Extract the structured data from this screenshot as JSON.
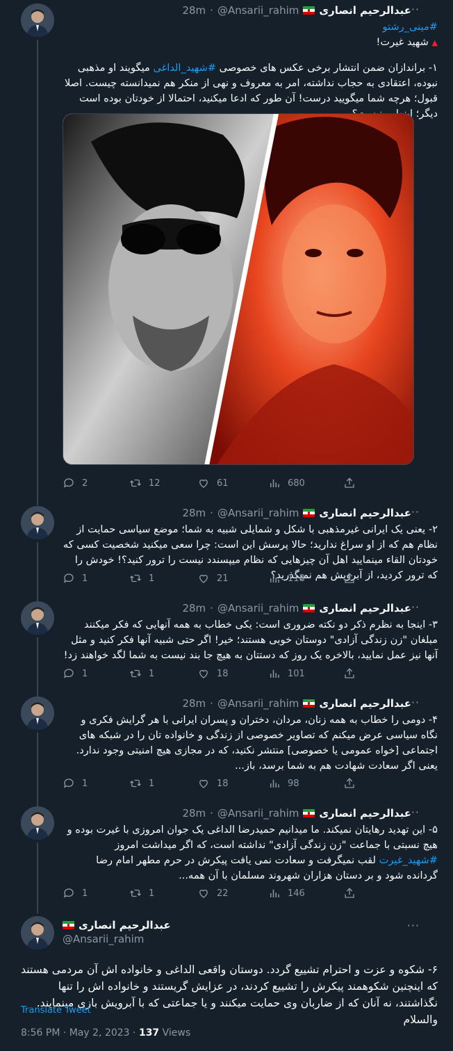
{
  "author": {
    "name": "عبدالرحیم انصاری",
    "handle": "@Ansarii_rahim",
    "flag": "iran-flag-icon"
  },
  "tweets": [
    {
      "time": "28m",
      "hashtag_top": "#مینی_رشتو",
      "subtitle": "شهید غیرت!",
      "text_pre": "۱- براندازان ضمن انتشار برخی عکس های خصوصی ",
      "text_tag": "#شهید_الداغی",
      "text_post": " میگویند او مذهبی نبوده، اعتقادی به حجاب نداشته، امر به معروف و نهی از منکر هم نمیدانسته چیست. اصلا قبول؛ هرچه شما میگویید درست! آن طور که ادعا میکنید، احتمالا از خودتان بوده است دیگر؛ اینطور نیست؟",
      "replies": "2",
      "retweets": "12",
      "likes": "61",
      "views": "680"
    },
    {
      "time": "28m",
      "text": "۲- یعنی یک ایرانی غیرمذهبی با شکل و شمایلی شبیه به شما؛ موضع سیاسی حمایت از نظام هم که از او سراغ ندارید؛ حالا پرسش این است: چرا سعی میکنید شخصیت کسی که خودتان القاء مینمایید اهل آن چیزهایی که نظام میپسندد نیست را ترور کنید؟! خودش را که ترور کردید، از آبرویش هم نمیگذرید؟",
      "replies": "1",
      "retweets": "1",
      "likes": "21",
      "views": "118"
    },
    {
      "time": "28m",
      "text": "۳- اینجا به نظرم ذکر دو نکته ضروری است: یکی خطاب به همه آنهایی که فکر میکنند مبلغان \"زن زندگی آزادی\" دوستان خوبی هستند؛ خیر! اگر حتی شبیه آنها فکر کنید و مثل آنها نیز عمل نمایید، بالاخره یک روز که دستتان به هیچ جا بند نیست به شما لگد خواهند زد!",
      "replies": "1",
      "retweets": "1",
      "likes": "18",
      "views": "101"
    },
    {
      "time": "28m",
      "text": "۴- دومی را خطاب به همه زنان، مردان، دختران و پسران ایرانی با هر گرایش فکری و نگاه سیاسی عرض میکنم که تصاویر خصوصی از زندگی و خانواده تان را در شبکه های اجتماعی [خواه عمومی یا خصوصی] منتشر نکنید، که در مجازی هیچ امنیتی وجود ندارد. یعنی اگر سعادت شهادت هم به شما برسد، باز...",
      "replies": "1",
      "retweets": "1",
      "likes": "18",
      "views": "98"
    },
    {
      "time": "28m",
      "text_pre": "۵- این تهدید رهایتان نمیکند. ما میدانیم حمیدرضا الداغی یک جوان امروزی با غیرت بوده و هیچ نسبتی با جماعت \"زن زندگی آزادی\" نداشته است، که اگر میداشت امروز ",
      "text_tag": "#شهید_غیرت",
      "text_post": " لقب نمیگرفت و سعادت نمی یافت پیکرش در حرم مطهر امام رضا گردانده شود و بر دستان هزاران شهروند مسلمان با آن همه...",
      "replies": "1",
      "retweets": "1",
      "likes": "22",
      "views": "146"
    }
  ],
  "detail": {
    "text": "۶- شکوه و عزت و احترام تشییع گردد. دوستان واقعی الداغی و خانواده اش آن مردمی هستند که اینچنین شکوهمند پیکرش را تشییع کردند، در عزایش گریستند و خانواده اش را تنها نگذاشتند، نه آنان که از ضاربان وی حمایت میکنند و یا جماعتی که با آبرویش بازی مینمایند. والسلام",
    "translate": "Translate Tweet",
    "timestamp": "8:56 PM · May 2, 2023 · ",
    "views_count": "137",
    "views_label": " Views"
  },
  "more_label": "···",
  "dot": "·"
}
